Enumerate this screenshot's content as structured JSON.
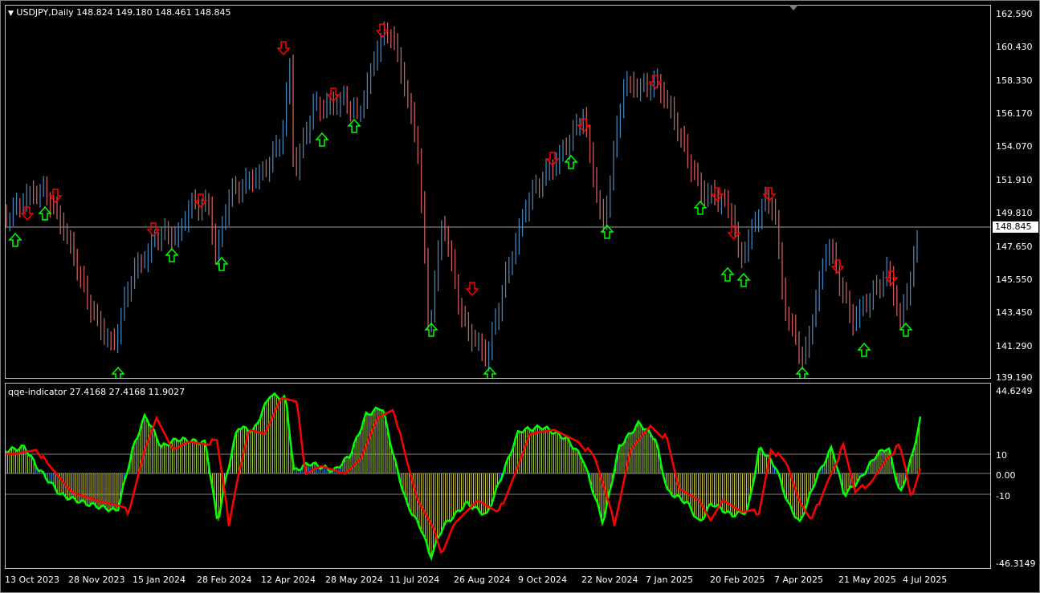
{
  "window": {
    "menu_icon": "triangle-down-icon",
    "main_title": "USDJPY,Daily  148.824 149.180 148.461 148.845",
    "indicator_title": "qqe-indicator 27.4168 27.4168 11.9027"
  },
  "price_axis": {
    "labels": [
      "162.590",
      "160.430",
      "158.330",
      "156.170",
      "154.070",
      "151.910",
      "149.810",
      "147.650",
      "145.550",
      "143.450",
      "141.290",
      "139.190"
    ],
    "current_price": "148.845"
  },
  "indicator_axis": {
    "max_label": "44.6249",
    "upper_level": "10",
    "zero_label": "0.00",
    "lower_level": "-10",
    "min_label": "-46.3149"
  },
  "date_axis": [
    "13 Oct 2023",
    "28 Nov 2023",
    "15 Jan 2024",
    "28 Feb 2024",
    "12 Apr 2024",
    "28 May 2024",
    "11 Jul 2024",
    "26 Aug 2024",
    "9 Oct 2024",
    "22 Nov 2024",
    "7 Jan 2025",
    "20 Feb 2025",
    "7 Apr 2025",
    "21 May 2025",
    "4 Jul 2025"
  ],
  "colors": {
    "background": "#000000",
    "bull_bar": "#4682b4",
    "bear_bar": "#cd5c5c",
    "up_arrow": "#00ff00",
    "down_arrow": "#ff0000",
    "qqe_line": "#00ff00",
    "signal_line": "#ff0000",
    "hist_pos": "#9acd32",
    "hist_neg": "#cdc832",
    "hist_mid": "#1e90ff",
    "grid": "#808080"
  }
}
